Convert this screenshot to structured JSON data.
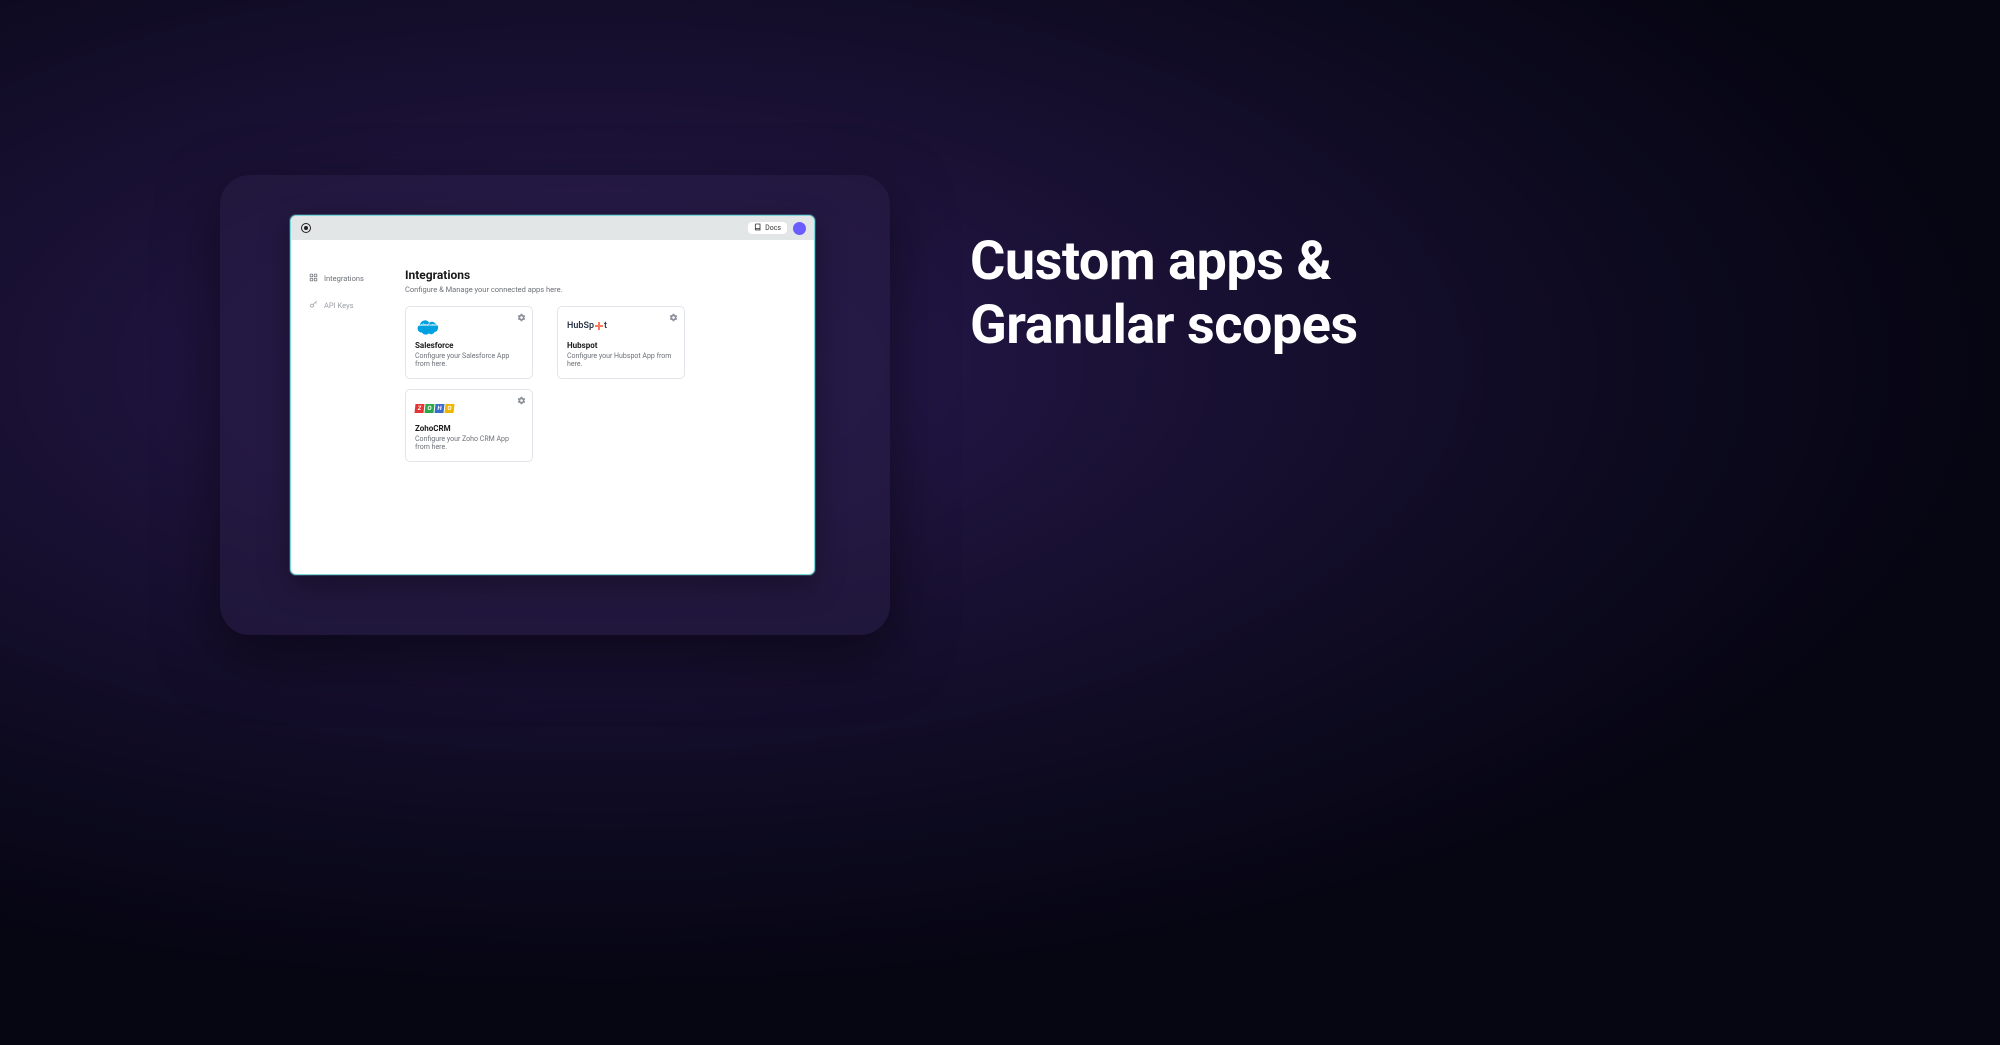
{
  "hero": {
    "line1": "Custom apps &",
    "line2": "Granular scopes"
  },
  "topbar": {
    "docs_label": "Docs"
  },
  "sidebar": {
    "items": [
      {
        "label": "Integrations"
      },
      {
        "label": "API Keys"
      }
    ]
  },
  "main": {
    "title": "Integrations",
    "subtitle": "Configure & Manage your connected apps here."
  },
  "cards": [
    {
      "logo_type": "salesforce",
      "title": "Salesforce",
      "desc": "Configure your Salesforce App from here."
    },
    {
      "logo_type": "hubspot",
      "title": "Hubspot",
      "desc": "Configure your Hubspot App from here."
    },
    {
      "logo_type": "zoho",
      "title": "ZohoCRM",
      "desc": "Configure your Zoho CRM App from here."
    }
  ]
}
